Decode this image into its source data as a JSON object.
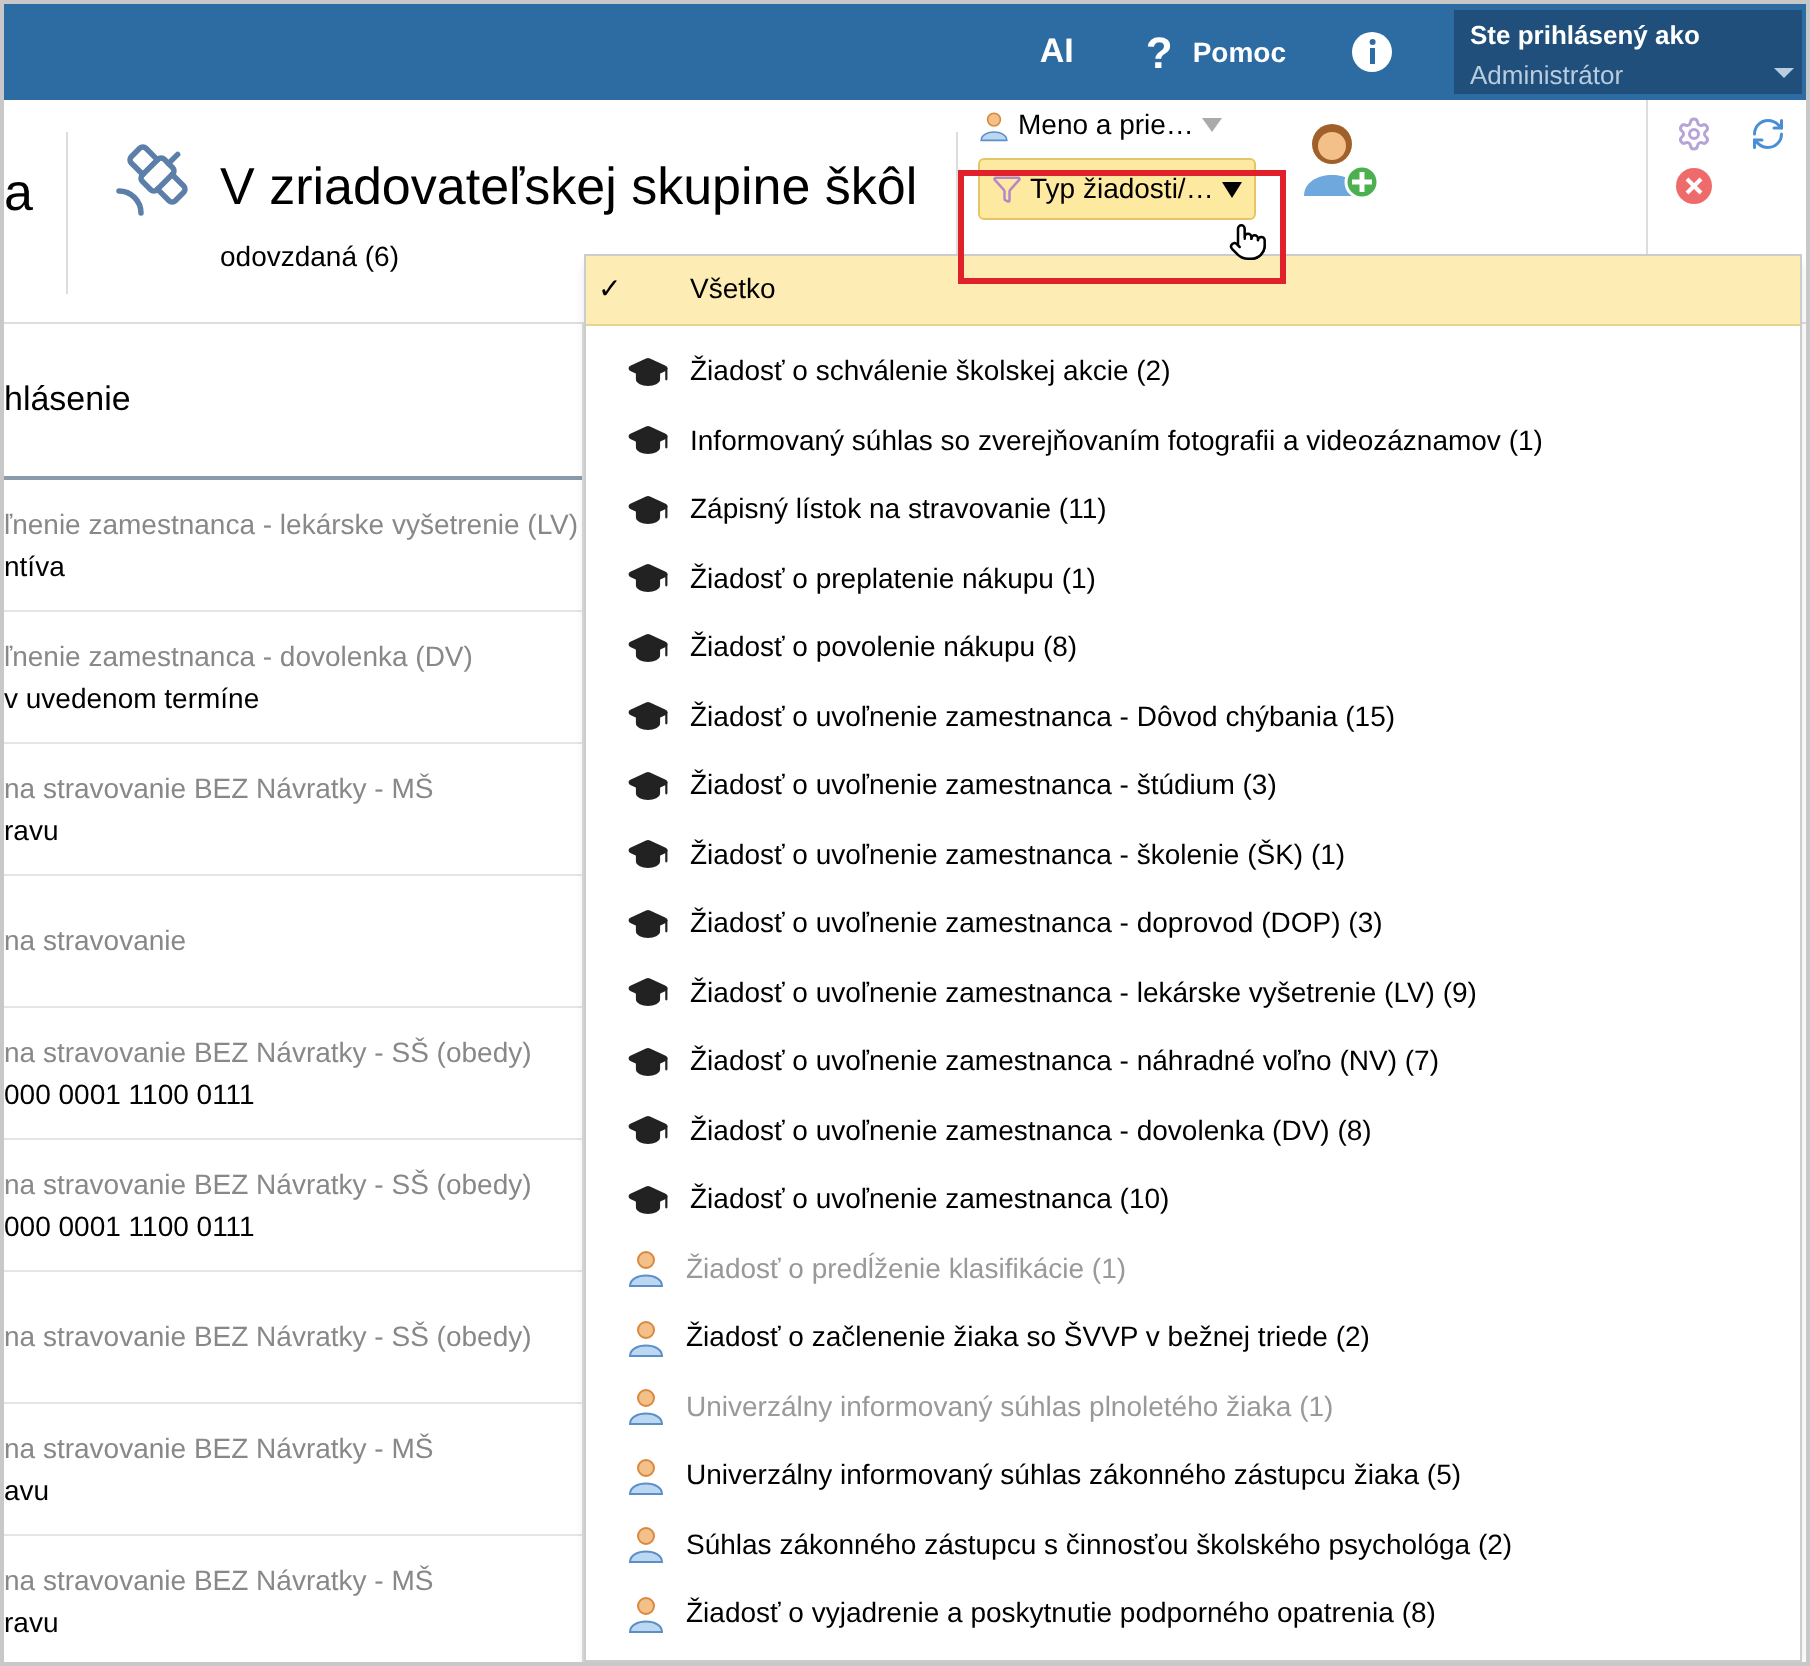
{
  "top_bar": {
    "ai": "AI",
    "help_icon": "?",
    "help": "Pomoc",
    "user": {
      "label": "Ste prihlásený ako",
      "name": "Administrátor"
    }
  },
  "header": {
    "cut_title": "a",
    "title": "V zriadovateľskej skupine škôl",
    "subtitle": "odovzdaná (6)",
    "name_filter": "Meno a prie…",
    "type_filter": "Typ žiadosti/…"
  },
  "table": {
    "column": "hlásenie",
    "rows": [
      {
        "type": "ľnenie zamestnanca - lekárske vyšetrenie (LV)",
        "detail": "ntíva"
      },
      {
        "type": "ľnenie zamestnanca - dovolenka (DV)",
        "detail": "v uvedenom termíne"
      },
      {
        "type": "na stravovanie BEZ Návratky - MŠ",
        "detail": "ravu"
      },
      {
        "type": "na stravovanie"
      },
      {
        "type": "na stravovanie BEZ Návratky - SŠ (obedy)",
        "detail": "000 0001 1100 0111"
      },
      {
        "type": "na stravovanie BEZ Návratky - SŠ (obedy)",
        "detail": "000 0001 1100 0111"
      },
      {
        "type": "na stravovanie BEZ Návratky - SŠ (obedy)"
      },
      {
        "type": "na stravovanie BEZ Návratky - MŠ",
        "detail": "avu"
      },
      {
        "type": "na stravovanie BEZ Návratky - MŠ",
        "detail": "ravu"
      }
    ]
  },
  "dropdown": {
    "check": "✓",
    "items": [
      {
        "kind": "all",
        "label": "Všetko",
        "selected": true,
        "disabled": false
      },
      {
        "kind": "school",
        "label": "Žiadosť o schválenie školskej akcie (2)",
        "selected": false,
        "disabled": false
      },
      {
        "kind": "school",
        "label": "Informovaný súhlas so zverejňovaním fotografii a videozáznamov (1)",
        "selected": false,
        "disabled": false
      },
      {
        "kind": "school",
        "label": "Zápisný lístok na stravovanie (11)",
        "selected": false,
        "disabled": false
      },
      {
        "kind": "school",
        "label": "Žiadosť o preplatenie nákupu (1)",
        "selected": false,
        "disabled": false
      },
      {
        "kind": "school",
        "label": "Žiadosť o povolenie nákupu (8)",
        "selected": false,
        "disabled": false
      },
      {
        "kind": "school",
        "label": "Žiadosť o uvoľnenie zamestnanca - Dôvod chýbania (15)",
        "selected": false,
        "disabled": false
      },
      {
        "kind": "school",
        "label": "Žiadosť o uvoľnenie zamestnanca - štúdium (3)",
        "selected": false,
        "disabled": false
      },
      {
        "kind": "school",
        "label": "Žiadosť o uvoľnenie zamestnanca - školenie (ŠK) (1)",
        "selected": false,
        "disabled": false
      },
      {
        "kind": "school",
        "label": "Žiadosť o uvoľnenie zamestnanca - doprovod (DOP) (3)",
        "selected": false,
        "disabled": false
      },
      {
        "kind": "school",
        "label": "Žiadosť o uvoľnenie zamestnanca - lekárske vyšetrenie (LV) (9)",
        "selected": false,
        "disabled": false
      },
      {
        "kind": "school",
        "label": "Žiadosť o uvoľnenie zamestnanca - náhradné voľno (NV) (7)",
        "selected": false,
        "disabled": false
      },
      {
        "kind": "school",
        "label": "Žiadosť o uvoľnenie zamestnanca - dovolenka (DV) (8)",
        "selected": false,
        "disabled": false
      },
      {
        "kind": "school",
        "label": "Žiadosť o uvoľnenie zamestnanca (10)",
        "selected": false,
        "disabled": false
      },
      {
        "kind": "person",
        "label": "Žiadosť o predĺženie klasifikácie (1)",
        "selected": false,
        "disabled": true
      },
      {
        "kind": "person",
        "label": "Žiadosť o začlenenie žiaka so ŠVVP v bežnej triede (2)",
        "selected": false,
        "disabled": false
      },
      {
        "kind": "person",
        "label": "Univerzálny informovaný súhlas plnoletého žiaka (1)",
        "selected": false,
        "disabled": true
      },
      {
        "kind": "person",
        "label": "Univerzálny informovaný súhlas zákonného zástupcu žiaka (5)",
        "selected": false,
        "disabled": false
      },
      {
        "kind": "person",
        "label": "Súhlas zákonného zástupcu s činnosťou školského psychológa (2)",
        "selected": false,
        "disabled": false
      },
      {
        "kind": "person",
        "label": "Žiadosť o vyjadrenie a poskytnutie podporného opatrenia (8)",
        "selected": false,
        "disabled": false
      }
    ]
  }
}
